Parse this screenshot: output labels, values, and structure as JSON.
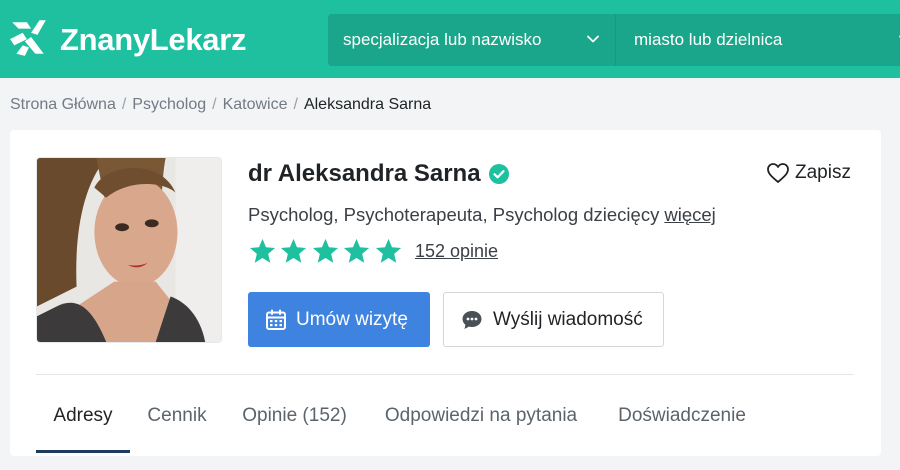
{
  "header": {
    "logo_text": "ZnanyLekarz",
    "search_specialty": "specjalizacja lub nazwisko",
    "search_location": "miasto lub dzielnica"
  },
  "breadcrumb": {
    "items": [
      "Strona Główna",
      "Psycholog",
      "Katowice"
    ],
    "current": "Aleksandra Sarna"
  },
  "profile": {
    "name": "dr Aleksandra Sarna",
    "save_label": "Zapisz",
    "specialties": "Psycholog, Psychoterapeuta, Psycholog dziecięcy",
    "more_label": "więcej",
    "rating": 5,
    "reviews_label": "152 opinie",
    "book_label": "Umów wizytę",
    "message_label": "Wyślij wiadomość"
  },
  "tabs": [
    {
      "label": "Adresy",
      "active": true
    },
    {
      "label": "Cennik",
      "active": false
    },
    {
      "label": "Opinie (152)",
      "active": false
    },
    {
      "label": "Odpowiedzi na pytania",
      "active": false
    },
    {
      "label": "Doświadczenie",
      "active": false
    }
  ],
  "colors": {
    "brand": "#1ec0a0",
    "brand_dark": "#1aa68a",
    "primary_button": "#3d83df",
    "star": "#1ec0a0",
    "active_tab_underline": "#1f3c5c"
  },
  "icons": {
    "logo": "znanylekarz-logo-icon",
    "verified": "verified-badge-icon",
    "save": "heart-icon",
    "book": "calendar-icon",
    "message": "chat-bubble-icon",
    "chevron": "chevron-down-icon"
  }
}
